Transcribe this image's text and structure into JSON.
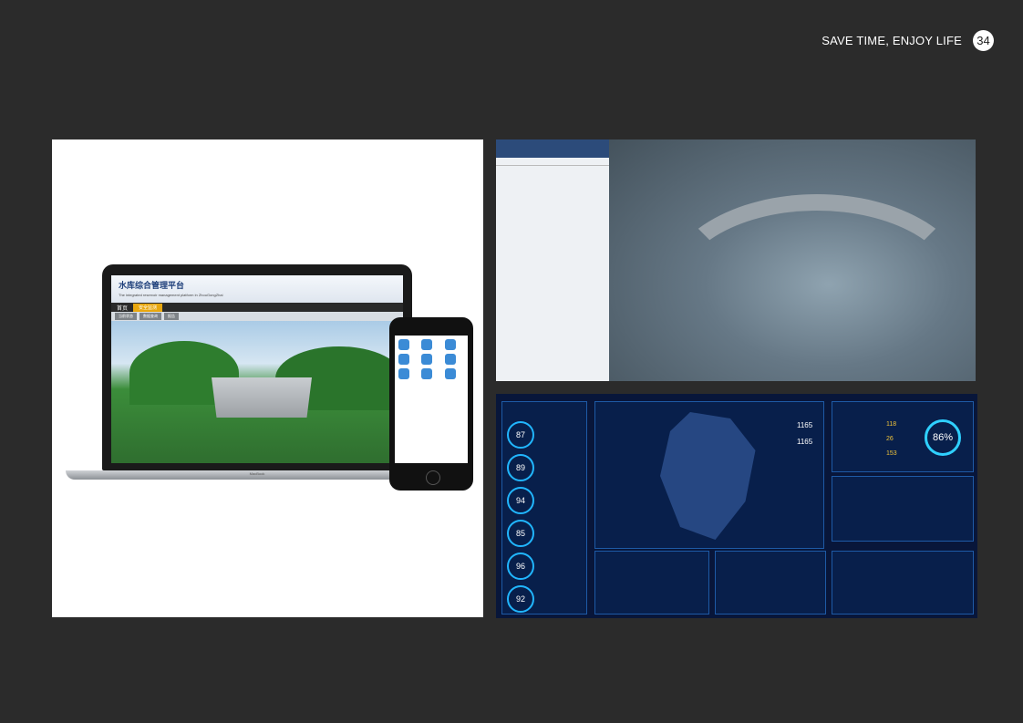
{
  "header": {
    "tagline": "SAVE TIME, ENJOY LIFE",
    "page_number": "34"
  },
  "laptop_app": {
    "title": "水库综合管理平台",
    "subtitle": "The integrated reservoir management platform in ZhouGongZhai",
    "nav_home": "首页",
    "nav_tab": "安全监测",
    "sub_tabs": [
      "当前状态",
      "数据查询",
      "报告"
    ],
    "brand": "MacBook"
  },
  "dashboard": {
    "gauges": [
      "87",
      "89",
      "94",
      "85",
      "96",
      "92"
    ],
    "big_gauge": "86%",
    "stats": [
      "1165",
      "1165"
    ],
    "mini_values": [
      "118",
      "26",
      "153"
    ]
  },
  "colors": {
    "background": "#2b2b2b",
    "accent": "#21b6ff"
  }
}
